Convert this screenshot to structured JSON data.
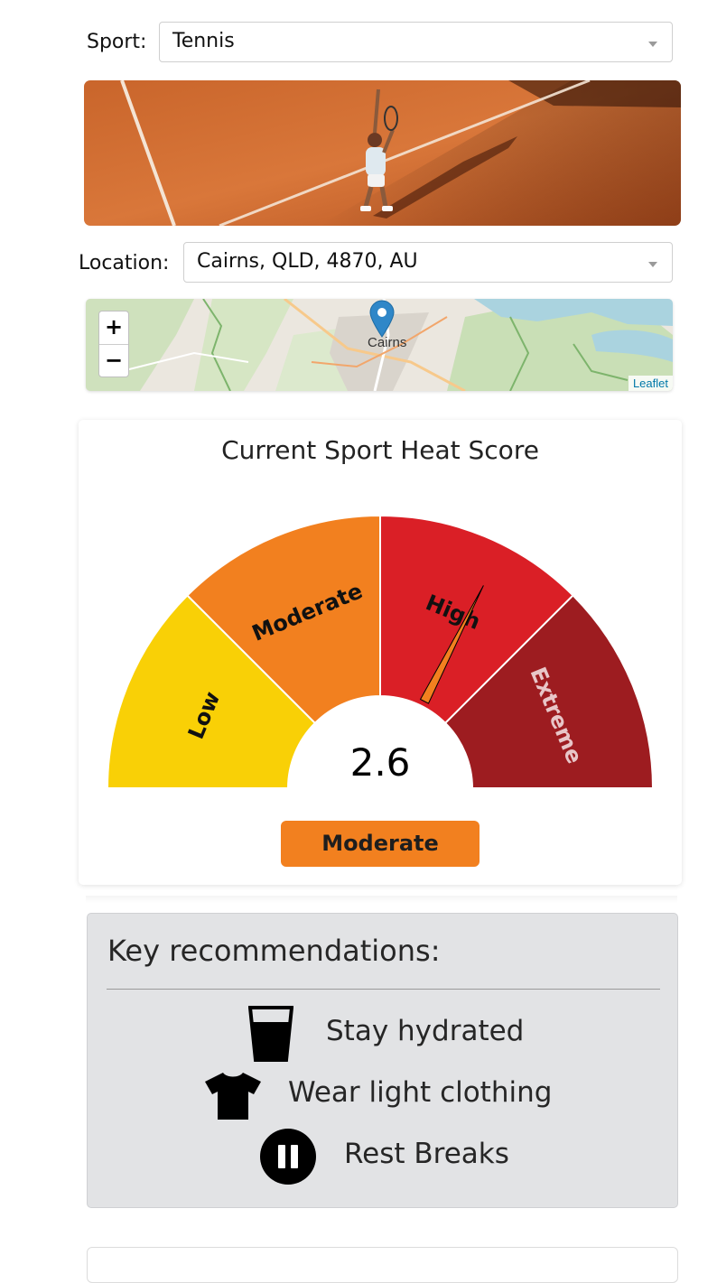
{
  "sport": {
    "label": "Sport:",
    "selected": "Tennis"
  },
  "location": {
    "label": "Location:",
    "selected": "Cairns, QLD, 4870, AU"
  },
  "map": {
    "zoom_in": "+",
    "zoom_out": "−",
    "place_label": "Cairns",
    "attribution": "Leaflet"
  },
  "gauge": {
    "title": "Current Sport Heat Score",
    "value": 2.6,
    "value_text": "2.6",
    "min": 0,
    "max": 4,
    "bands": [
      {
        "label": "Low",
        "from": 0,
        "to": 1,
        "color": "#F9D006"
      },
      {
        "label": "Moderate",
        "from": 1,
        "to": 2,
        "color": "#F2801F"
      },
      {
        "label": "High",
        "from": 2,
        "to": 3,
        "color": "#DA1F26"
      },
      {
        "label": "Extreme",
        "from": 3,
        "to": 4,
        "color": "#9D1C20"
      }
    ],
    "level": "Moderate",
    "level_color": "#F2801F"
  },
  "recommendations": {
    "title": "Key recommendations:",
    "items": [
      {
        "label": "Stay hydrated",
        "icon": "glass-icon"
      },
      {
        "label": "Wear light clothing",
        "icon": "tshirt-icon"
      },
      {
        "label": "Rest Breaks",
        "icon": "pause-icon"
      }
    ]
  }
}
